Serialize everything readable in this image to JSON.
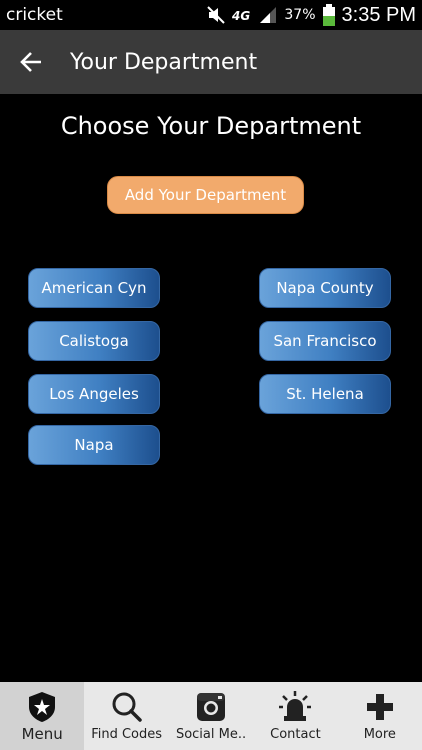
{
  "status_bar": {
    "carrier": "cricket",
    "network": "4G",
    "battery_percent": "37%",
    "time": "3:35 PM",
    "icons": [
      "mute-icon",
      "network-4g-icon",
      "signal-icon",
      "battery-icon"
    ]
  },
  "action_bar": {
    "title": "Your Department",
    "back_icon": "arrow-left-icon"
  },
  "main": {
    "heading": "Choose Your Department",
    "add_button_label": "Add Your Department",
    "departments": [
      "American Cyn",
      "Napa County",
      "Calistoga",
      "San Francisco",
      "Los Angeles",
      "St. Helena",
      "Napa"
    ]
  },
  "bottom_nav": {
    "items": [
      {
        "label": "Menu",
        "icon": "badge-star-icon",
        "active": true
      },
      {
        "label": "Find Codes",
        "icon": "search-icon",
        "active": false
      },
      {
        "label": "Social Me..",
        "icon": "instagram-icon",
        "active": false
      },
      {
        "label": "Contact",
        "icon": "siren-icon",
        "active": false
      },
      {
        "label": "More",
        "icon": "plus-icon",
        "active": false
      }
    ]
  },
  "colors": {
    "action_bar": "#3a3a3a",
    "add_button": "#f2aa6c",
    "dept_button_light": "#6aa3da",
    "dept_button_dark": "#1d4f8e",
    "nav_background": "#e8e8e8"
  }
}
